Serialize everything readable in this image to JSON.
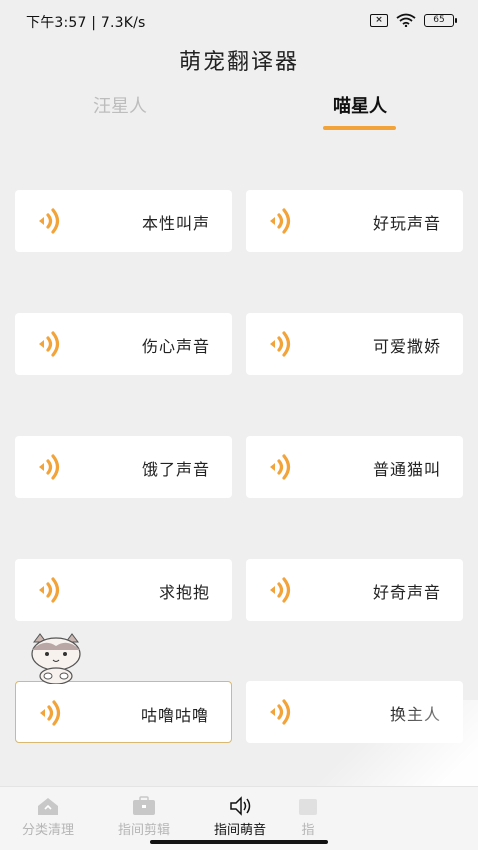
{
  "status_bar": {
    "left_text": "下午3:57 | 7.3K/s ",
    "sim_glyph": "×",
    "battery": "65"
  },
  "title": "萌宠翻译器",
  "tabs": [
    {
      "label": "汪星人",
      "active": false
    },
    {
      "label": "喵星人",
      "active": true
    }
  ],
  "sounds": [
    {
      "label": "本性叫声"
    },
    {
      "label": "好玩声音"
    },
    {
      "label": "伤心声音"
    },
    {
      "label": "可爱撒娇"
    },
    {
      "label": "饿了声音"
    },
    {
      "label": "普通猫叫"
    },
    {
      "label": "求抱抱"
    },
    {
      "label": "好奇声音"
    },
    {
      "label": "咕噜咕噜",
      "selected": true
    },
    {
      "label": "换主人"
    }
  ],
  "bottom_nav": [
    {
      "label": "分类清理",
      "icon": "home-clean-icon",
      "active": false
    },
    {
      "label": "指间剪辑",
      "icon": "briefcase-icon",
      "active": false
    },
    {
      "label": "指间萌音",
      "icon": "speaker-icon",
      "active": true
    },
    {
      "label": "指",
      "icon": "more-icon",
      "active": false
    }
  ],
  "colors": {
    "accent": "#f2a33a",
    "background": "#efefef",
    "card": "#ffffff",
    "inactive_text": "#bdbdbd"
  }
}
